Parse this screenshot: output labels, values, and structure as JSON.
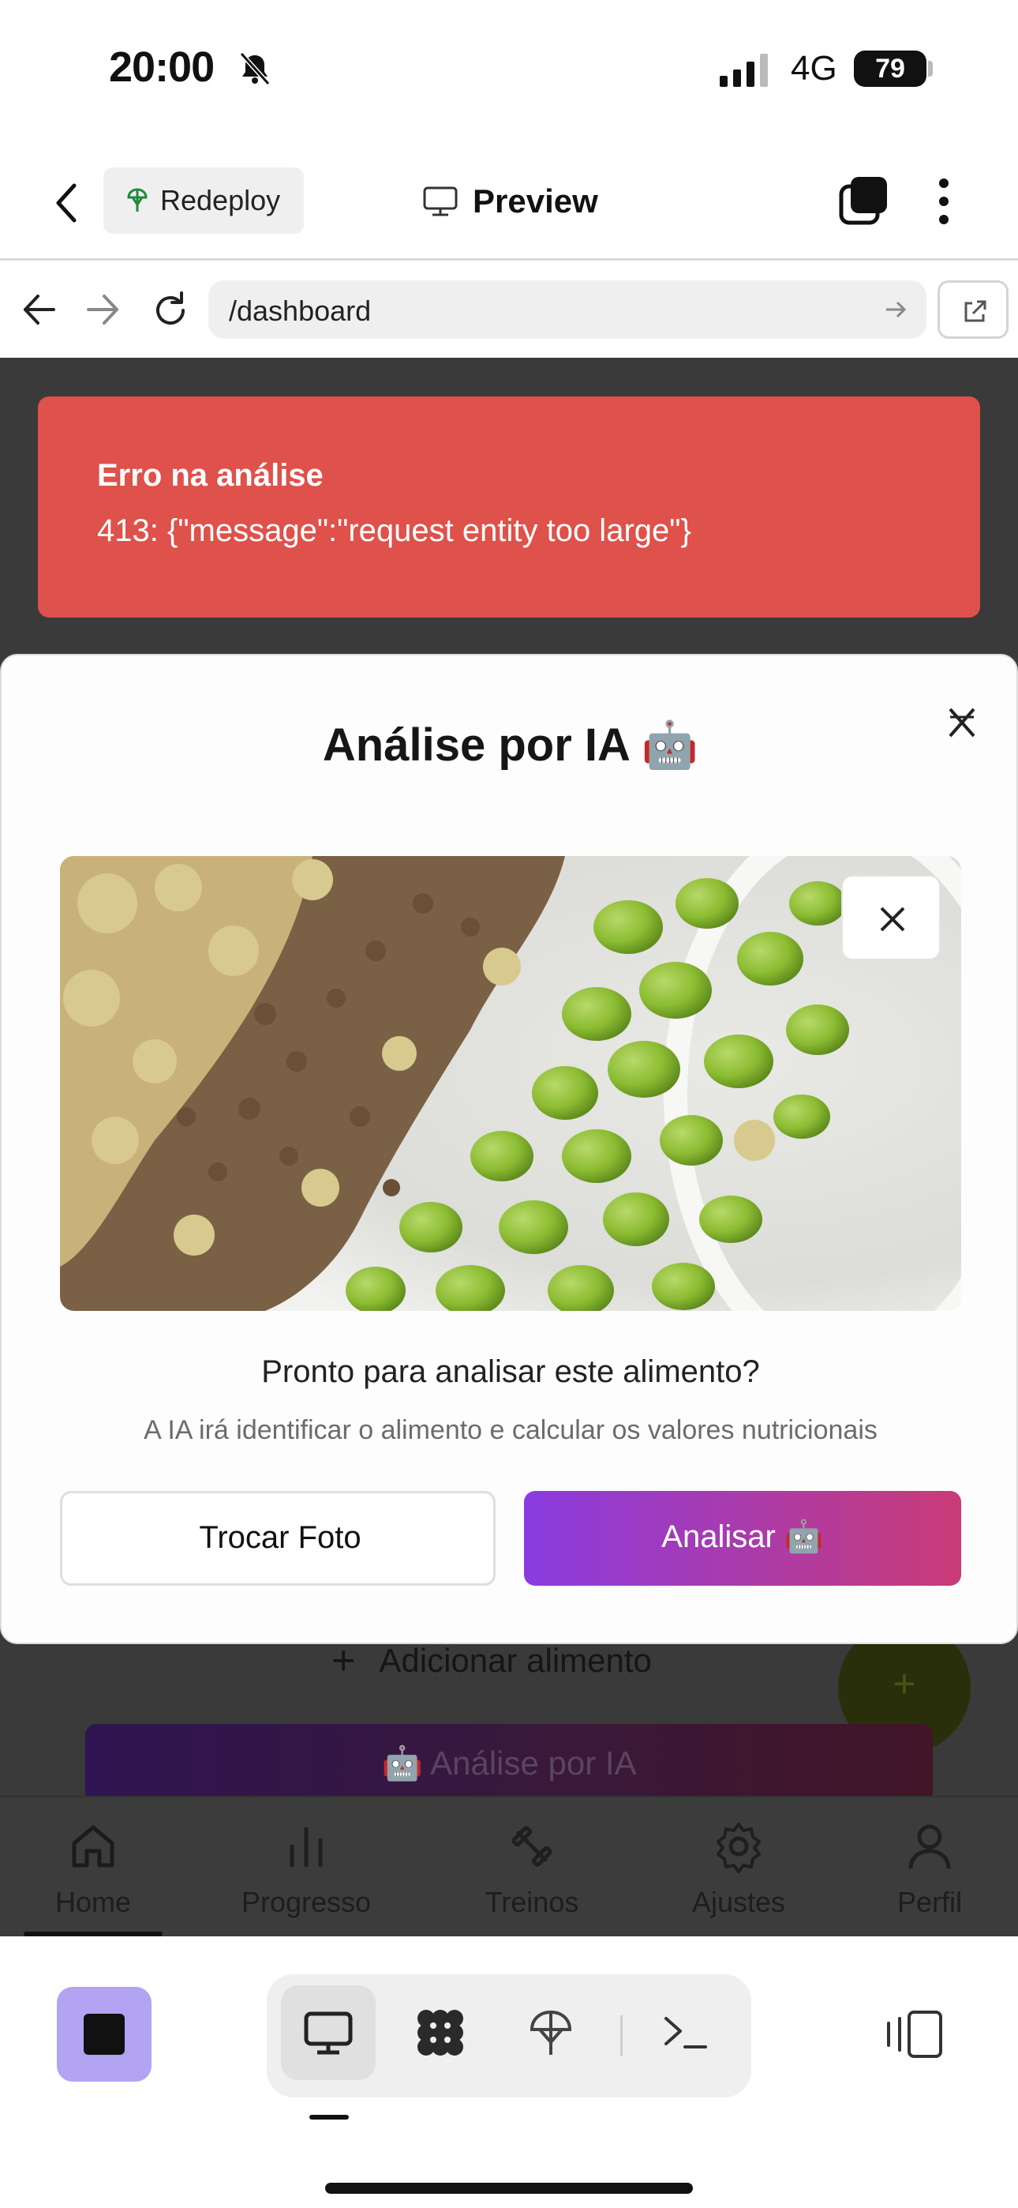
{
  "status_bar": {
    "time": "20:00",
    "network": "4G",
    "battery": "79"
  },
  "header": {
    "redeploy_label": "Redeploy",
    "preview_label": "Preview"
  },
  "browser": {
    "url": "/dashboard"
  },
  "page": {
    "add_food_label": "Adicionar alimento",
    "ai_banner_label": "🤖 Análise por IA",
    "fab_symbol": "+",
    "add_food_symbol": "+",
    "nav": [
      {
        "label": "Home",
        "icon": "home-icon"
      },
      {
        "label": "Progresso",
        "icon": "bar-chart-icon"
      },
      {
        "label": "Treinos",
        "icon": "dumbbell-icon"
      },
      {
        "label": "Ajustes",
        "icon": "gear-icon"
      },
      {
        "label": "Perfil",
        "icon": "user-icon"
      }
    ]
  },
  "toast": {
    "title": "Erro na análise",
    "message": "413: {\"message\":\"request entity too large\"}"
  },
  "modal": {
    "title": "Análise por IA 🤖",
    "ready_text": "Pronto para analisar este alimento?",
    "hint_text": "A IA irá identificar o alimento e calcular os valores nutricionais",
    "swap_label": "Trocar Foto",
    "analyze_label": "Analisar 🤖"
  },
  "colors": {
    "toast_bg": "#df514b",
    "analyze_gradient_start": "#8a3be0",
    "analyze_gradient_end": "#c93b77",
    "stop_button": "#b3a3f3"
  }
}
